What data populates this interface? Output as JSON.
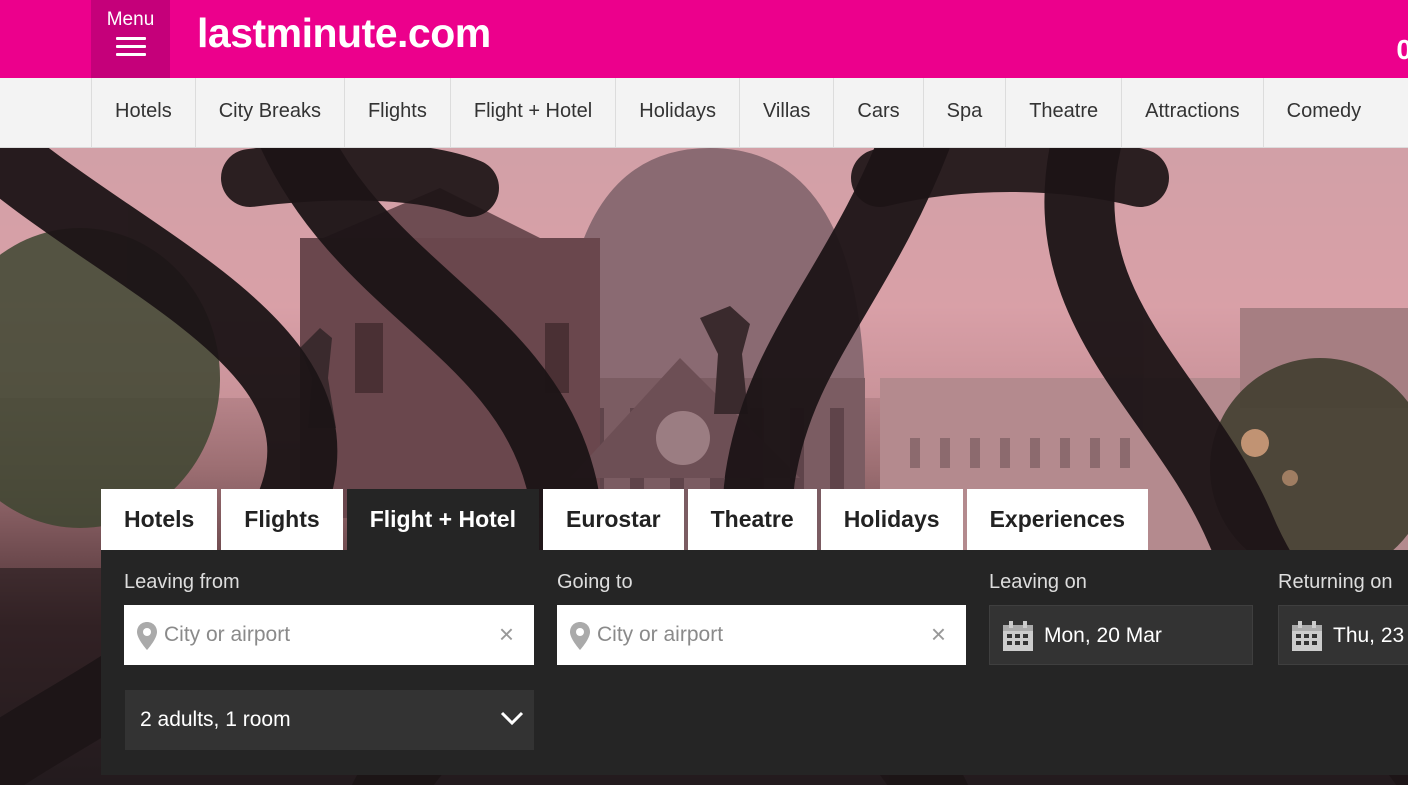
{
  "header": {
    "menu_label": "Menu",
    "logo": "lastminute.com",
    "right_partial": "0",
    "brand_color": "#ec008c"
  },
  "nav": {
    "items": [
      "Hotels",
      "City Breaks",
      "Flights",
      "Flight + Hotel",
      "Holidays",
      "Villas",
      "Cars",
      "Spa",
      "Theatre",
      "Attractions",
      "Comedy"
    ]
  },
  "search": {
    "tabs": [
      "Hotels",
      "Flights",
      "Flight + Hotel",
      "Eurostar",
      "Theatre",
      "Holidays",
      "Experiences"
    ],
    "active_tab": "Flight + Hotel",
    "leaving_from": {
      "label": "Leaving from",
      "placeholder": "City or airport",
      "clear": "×"
    },
    "going_to": {
      "label": "Going to",
      "placeholder": "City or airport",
      "clear": "×"
    },
    "leaving_on": {
      "label": "Leaving on",
      "value": "Mon, 20 Mar"
    },
    "returning_on": {
      "label": "Returning on",
      "value": "Thu, 23"
    },
    "guests": {
      "value": "2 adults, 1 room"
    }
  },
  "icons": {
    "menu": "hamburger-icon",
    "location": "map-pin-icon",
    "calendar": "calendar-icon",
    "dropdown": "chevron-down-icon"
  }
}
